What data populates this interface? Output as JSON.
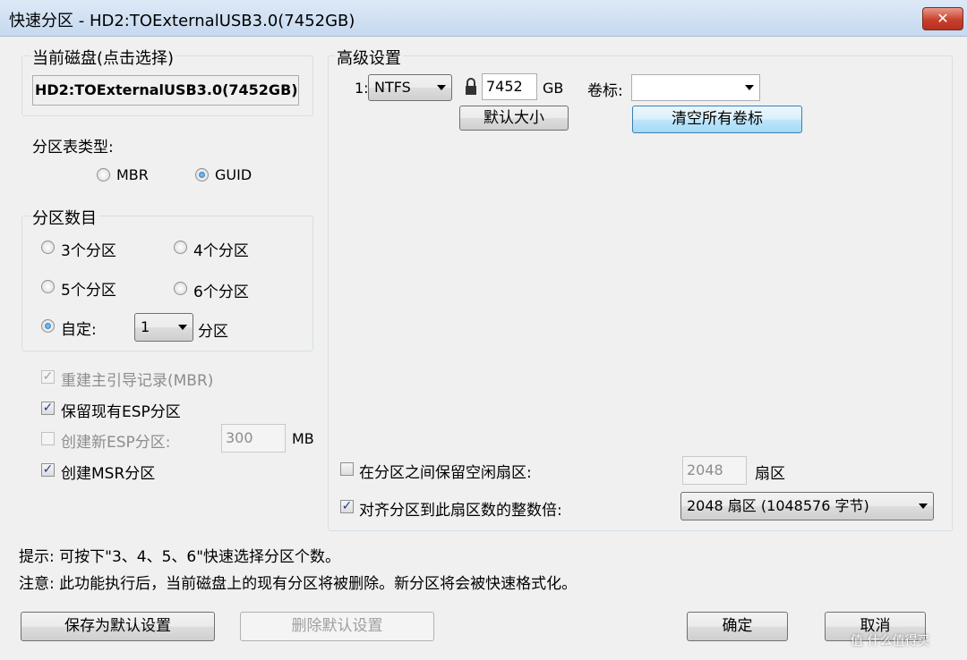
{
  "window": {
    "title": "快速分区 - HD2:TOExternalUSB3.0(7452GB)",
    "close_label": "✕"
  },
  "disk": {
    "group_label": "当前磁盘(点击选择)",
    "selected": "HD2:TOExternalUSB3.0(7452GB) -"
  },
  "partition_table": {
    "label": "分区表类型:",
    "options": [
      {
        "label": "MBR",
        "selected": false
      },
      {
        "label": "GUID",
        "selected": true
      }
    ]
  },
  "partition_count": {
    "group_label": "分区数目",
    "opt3": "3个分区",
    "opt4": "4个分区",
    "opt5": "5个分区",
    "opt6": "6个分区",
    "custom_label": "自定:",
    "custom_value": "1",
    "custom_suffix": "分区"
  },
  "options": {
    "rebuild_mbr": "重建主引导记录(MBR)",
    "keep_esp": "保留现有ESP分区",
    "create_esp": "创建新ESP分区:",
    "esp_size": "300",
    "esp_unit": "MB",
    "create_msr": "创建MSR分区"
  },
  "advanced": {
    "group_label": "高级设置",
    "row_index": "1:",
    "fs": "NTFS",
    "size": "7452",
    "size_unit": "GB",
    "volume_label": "卷标:",
    "volume_value": "",
    "default_size_btn": "默认大小",
    "clear_labels_btn": "清空所有卷标",
    "reserve_label": "在分区之间保留空闲扇区:",
    "reserve_value": "2048",
    "reserve_unit": "扇区",
    "align_label": "对齐分区到此扇区数的整数倍:",
    "align_value": "2048 扇区 (1048576 字节)"
  },
  "notes": {
    "hint": "提示: 可按下\"3、4、5、6\"快速选择分区个数。",
    "warning": "注意: 此功能执行后，当前磁盘上的现有分区将被删除。新分区将会被快速格式化。"
  },
  "footer": {
    "save_default": "保存为默认设置",
    "delete_default": "删除默认设置",
    "ok": "确定",
    "cancel": "取消"
  },
  "watermark": "值 什么值得买"
}
